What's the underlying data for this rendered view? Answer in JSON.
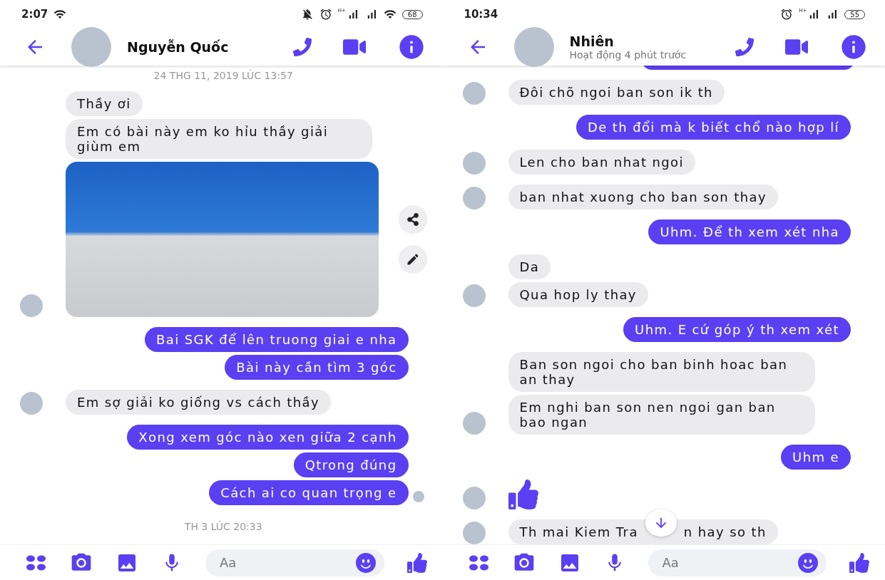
{
  "phones": [
    {
      "status_bar": {
        "time": "2:07",
        "left_icons": [
          {
            "kind": "wifi"
          }
        ],
        "right_icons": [
          {
            "kind": "muted"
          },
          {
            "kind": "alarm"
          },
          {
            "kind": "signal",
            "label": "H+"
          },
          {
            "kind": "signal"
          },
          {
            "kind": "wifi"
          }
        ],
        "battery": "68"
      },
      "header": {
        "name": "Nguyễn Quốc"
      },
      "messages": [
        {
          "kind": "date",
          "text": "24 THG 11, 2019 LÚC 13:57"
        },
        {
          "kind": "received",
          "text": "Thầy ơi",
          "avatar": false
        },
        {
          "kind": "received",
          "text": "Em có bài này em ko hỉu thầy giải giùm em",
          "avatar": false
        },
        {
          "kind": "photo",
          "avatar": true,
          "actions": [
            {
              "kind": "share"
            },
            {
              "kind": "edit"
            }
          ]
        },
        {
          "kind": "sent",
          "text": "Bai SGK để lên truong giai e nha",
          "seen": false
        },
        {
          "kind": "sent",
          "text": "Bài này cần tìm 3 góc",
          "seen": false
        },
        {
          "kind": "received",
          "text": "Em sợ giải ko giống vs cách thầy",
          "avatar": true
        },
        {
          "kind": "sent",
          "text": "Xong xem góc nào xen giữa 2 cạnh",
          "seen": false
        },
        {
          "kind": "sent",
          "text": "Qtrong đúng",
          "seen": false
        },
        {
          "kind": "sent",
          "text": "Cách ai co quan trọng e",
          "seen": true
        },
        {
          "kind": "date",
          "text": "TH 3 LÚC 20:33"
        }
      ],
      "composer": {
        "placeholder": "Aa"
      }
    },
    {
      "status_bar": {
        "time": "10:34",
        "right_icons": [
          {
            "kind": "alarm"
          },
          {
            "kind": "signal",
            "label": "H+"
          },
          {
            "kind": "signal"
          }
        ],
        "battery": "55"
      },
      "header": {
        "name": "Nhiên",
        "subtitle": "Hoạt động 4 phút trước"
      },
      "messages": [
        {
          "kind": "sent_cut"
        },
        {
          "kind": "received",
          "text": "Đôi chõ ngoi ban son ik th",
          "avatar": true
        },
        {
          "kind": "sent",
          "text": "De th đổi mà k biết chổ nào hợp lí",
          "seen": false
        },
        {
          "kind": "received",
          "text": "Len cho ban nhat  ngoi",
          "avatar": true
        },
        {
          "kind": "received",
          "text": "ban nhat xuong cho ban son thay",
          "avatar": true
        },
        {
          "kind": "sent",
          "text": "Uhm. Để th xem xét nha",
          "seen": false
        },
        {
          "kind": "received",
          "text": "Da",
          "avatar": false
        },
        {
          "kind": "received",
          "text": "Qua hop ly thay",
          "avatar": true
        },
        {
          "kind": "sent",
          "text": "Uhm. E cứ góp ý th xem xét",
          "seen": false
        },
        {
          "kind": "received",
          "text": "Ban son ngoi cho ban binh hoac ban an thay",
          "avatar": false
        },
        {
          "kind": "received",
          "text": "Em nghi ban son nen ngoi gan ban bao ngan",
          "avatar": true
        },
        {
          "kind": "sent",
          "text": "Uhm e",
          "seen": false
        },
        {
          "kind": "like",
          "avatar": true
        },
        {
          "kind": "received_covered",
          "parts": [
            "Th mai Kiem Tra",
            "n hay so th"
          ],
          "avatar": true
        }
      ],
      "composer": {
        "placeholder": "Aa"
      }
    }
  ]
}
